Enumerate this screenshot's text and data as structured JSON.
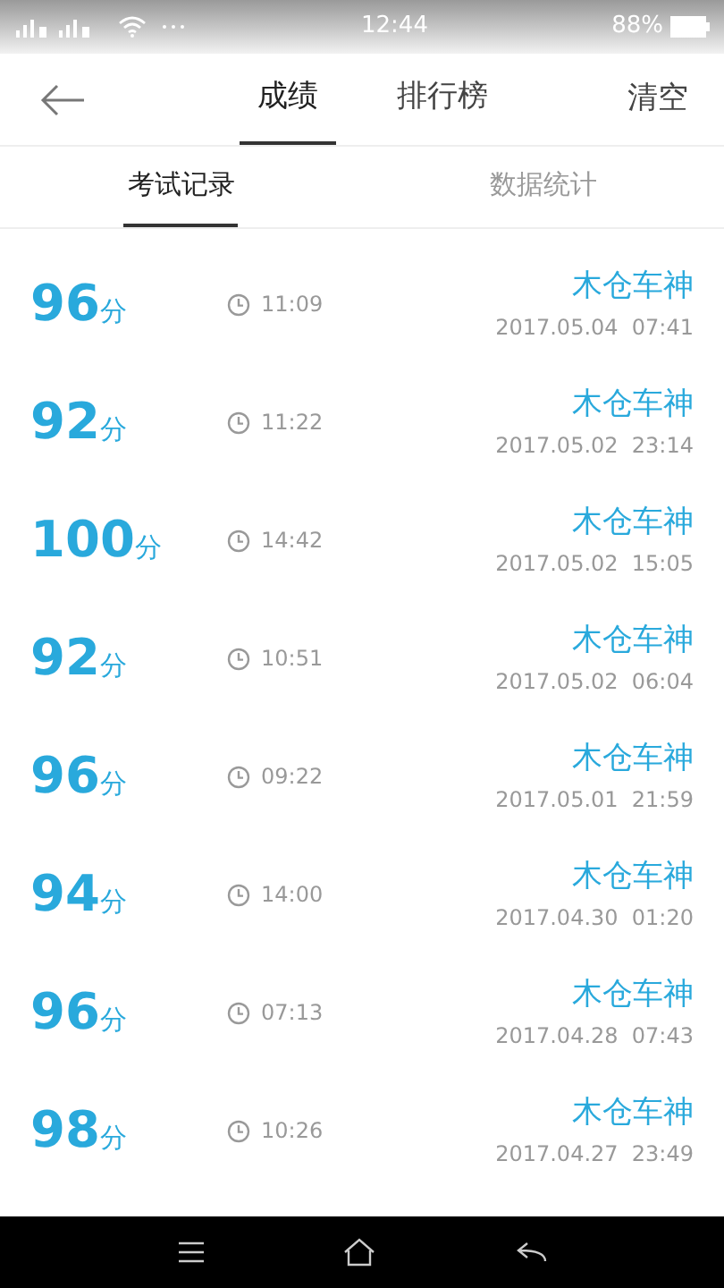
{
  "status_bar": {
    "time": "12:44",
    "battery": "88%"
  },
  "header": {
    "tabs": [
      {
        "label": "成绩",
        "selected": true
      },
      {
        "label": "排行榜",
        "selected": false
      }
    ],
    "action": "清空"
  },
  "sub_tabs": [
    {
      "label": "考试记录",
      "selected": true
    },
    {
      "label": "数据统计",
      "selected": false
    }
  ],
  "records": [
    {
      "score": "96",
      "unit": "分",
      "duration": "11:09",
      "name": "木仓车神",
      "date": "2017.05.04  07:41"
    },
    {
      "score": "92",
      "unit": "分",
      "duration": "11:22",
      "name": "木仓车神",
      "date": "2017.05.02  23:14"
    },
    {
      "score": "100",
      "unit": "分",
      "duration": "14:42",
      "name": "木仓车神",
      "date": "2017.05.02  15:05"
    },
    {
      "score": "92",
      "unit": "分",
      "duration": "10:51",
      "name": "木仓车神",
      "date": "2017.05.02  06:04"
    },
    {
      "score": "96",
      "unit": "分",
      "duration": "09:22",
      "name": "木仓车神",
      "date": "2017.05.01  21:59"
    },
    {
      "score": "94",
      "unit": "分",
      "duration": "14:00",
      "name": "木仓车神",
      "date": "2017.04.30  01:20"
    },
    {
      "score": "96",
      "unit": "分",
      "duration": "07:13",
      "name": "木仓车神",
      "date": "2017.04.28  07:43"
    },
    {
      "score": "98",
      "unit": "分",
      "duration": "10:26",
      "name": "木仓车神",
      "date": "2017.04.27  23:49"
    }
  ]
}
